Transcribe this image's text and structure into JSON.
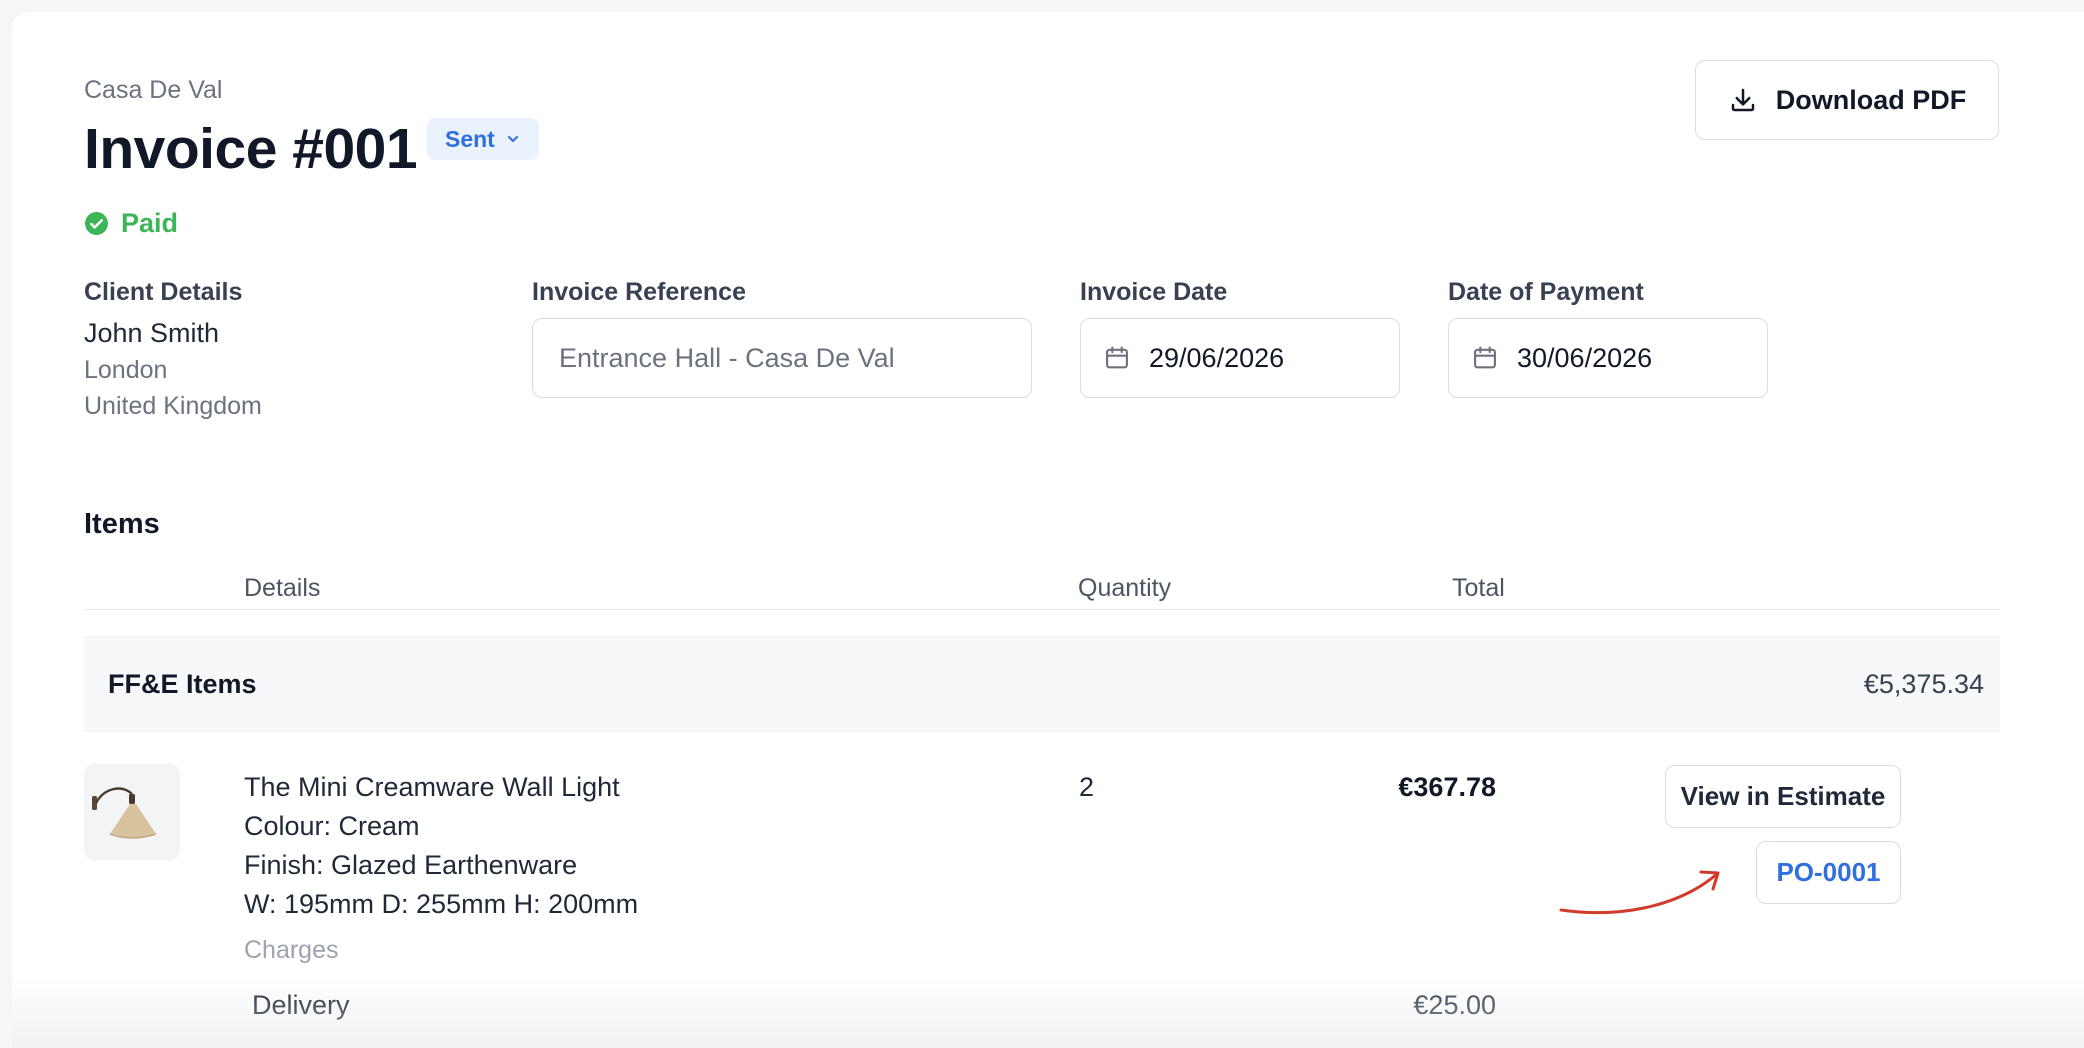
{
  "header": {
    "brand": "Casa De Val",
    "title": "Invoice #001",
    "status_badge": "Sent",
    "payment_status": "Paid",
    "download_label": "Download PDF"
  },
  "details": {
    "client_label": "Client Details",
    "client_name": "John Smith",
    "client_city": "London",
    "client_country": "United Kingdom",
    "reference_label": "Invoice Reference",
    "reference_placeholder": "Entrance Hall - Casa De Val",
    "invoice_date_label": "Invoice Date",
    "invoice_date": "29/06/2026",
    "payment_date_label": "Date of Payment",
    "payment_date": "30/06/2026"
  },
  "items": {
    "heading": "Items",
    "columns": {
      "details": "Details",
      "quantity": "Quantity",
      "total": "Total"
    },
    "section": {
      "name": "FF&E Items",
      "total": "€5,375.34"
    },
    "rows": [
      {
        "name": "The Mini Creamware Wall Light",
        "colour": "Colour: Cream",
        "finish": "Finish: Glazed Earthenware",
        "dimensions": "W: 195mm D: 255mm H: 200mm",
        "quantity": "2",
        "total": "€367.78",
        "view_estimate_label": "View in Estimate",
        "po_label": "PO-0001",
        "charges_label": "Charges",
        "charges": [
          {
            "label": "Delivery",
            "total": "€25.00"
          }
        ]
      }
    ]
  },
  "colors": {
    "accent_blue": "#2f6fdf",
    "paid_green": "#3bb557",
    "annotation_arrow": "#d13b2a"
  },
  "icons": {
    "download": "download-icon",
    "calendar": "calendar-icon",
    "check": "check-circle-icon",
    "chevron": "chevron-down-icon"
  }
}
